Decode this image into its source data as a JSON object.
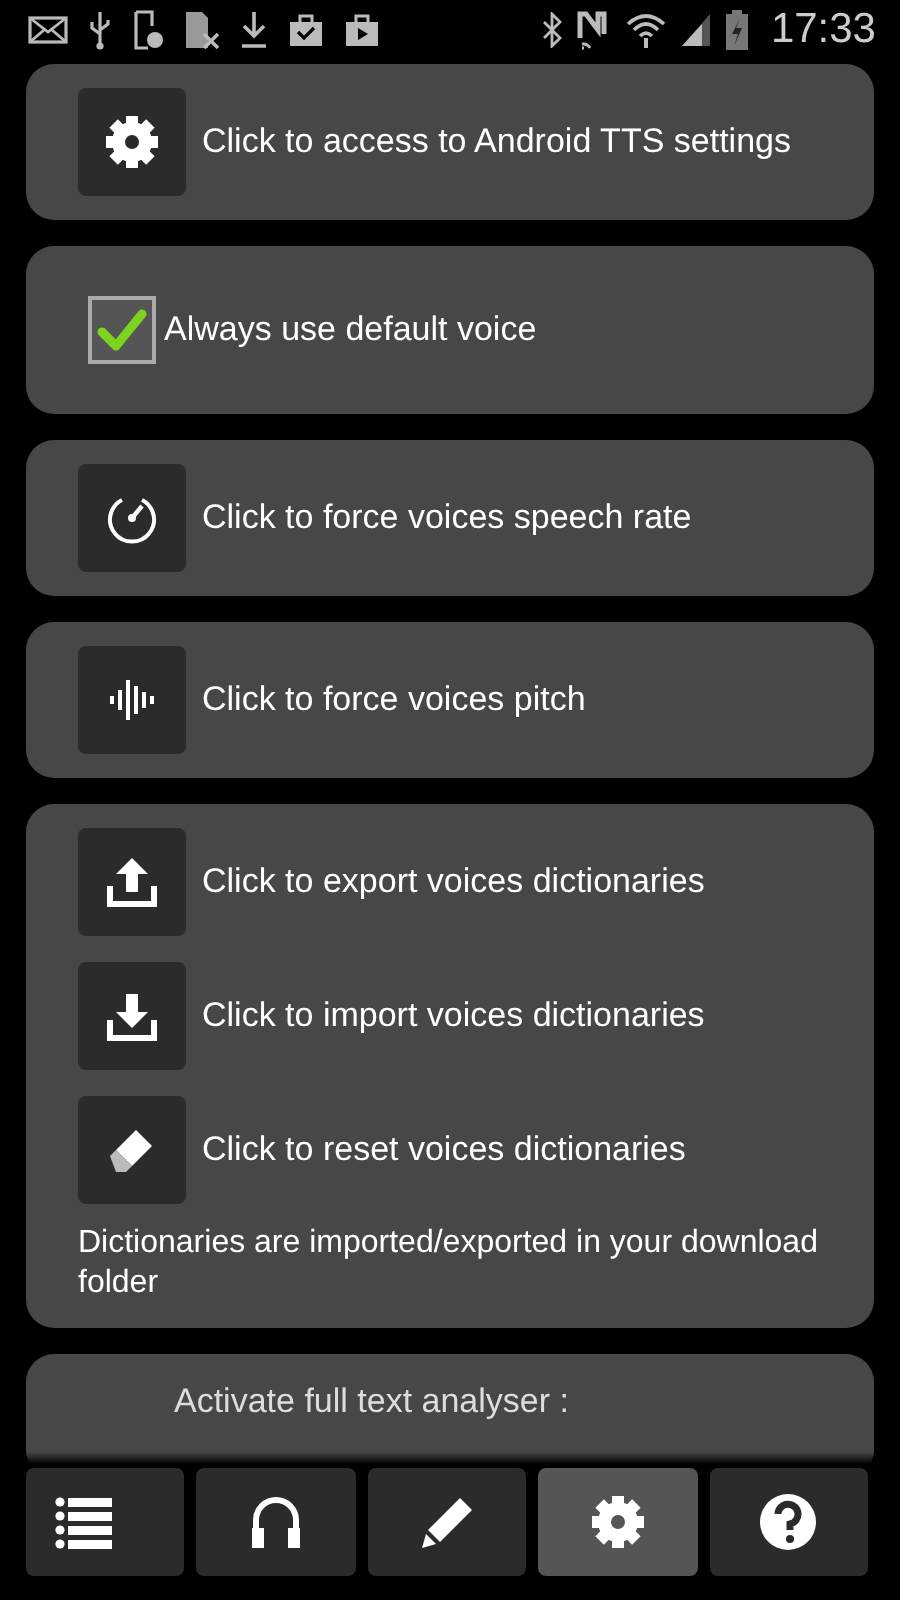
{
  "status_bar": {
    "time": "17:33"
  },
  "sections": [
    {
      "items": [
        {
          "kind": "button",
          "label": "Click to access to Android TTS settings"
        }
      ]
    },
    {
      "items": [
        {
          "kind": "checkbox",
          "checked": true,
          "label": "Always use default voice"
        }
      ]
    },
    {
      "items": [
        {
          "kind": "button",
          "label": "Click to force voices speech rate"
        }
      ]
    },
    {
      "items": [
        {
          "kind": "button",
          "label": "Click to force voices pitch"
        }
      ]
    },
    {
      "items": [
        {
          "kind": "button",
          "label": "Click to export voices dictionaries"
        },
        {
          "kind": "button",
          "label": "Click to import voices dictionaries"
        },
        {
          "kind": "button",
          "label": "Click to reset voices dictionaries"
        }
      ],
      "note": "Dictionaries are imported/exported in your download folder"
    },
    {
      "items": [
        {
          "kind": "heading",
          "label": "Activate full text analyser :"
        }
      ]
    }
  ],
  "nav": [
    {
      "selected": false
    },
    {
      "selected": false
    },
    {
      "selected": false
    },
    {
      "selected": true
    },
    {
      "selected": false
    }
  ]
}
